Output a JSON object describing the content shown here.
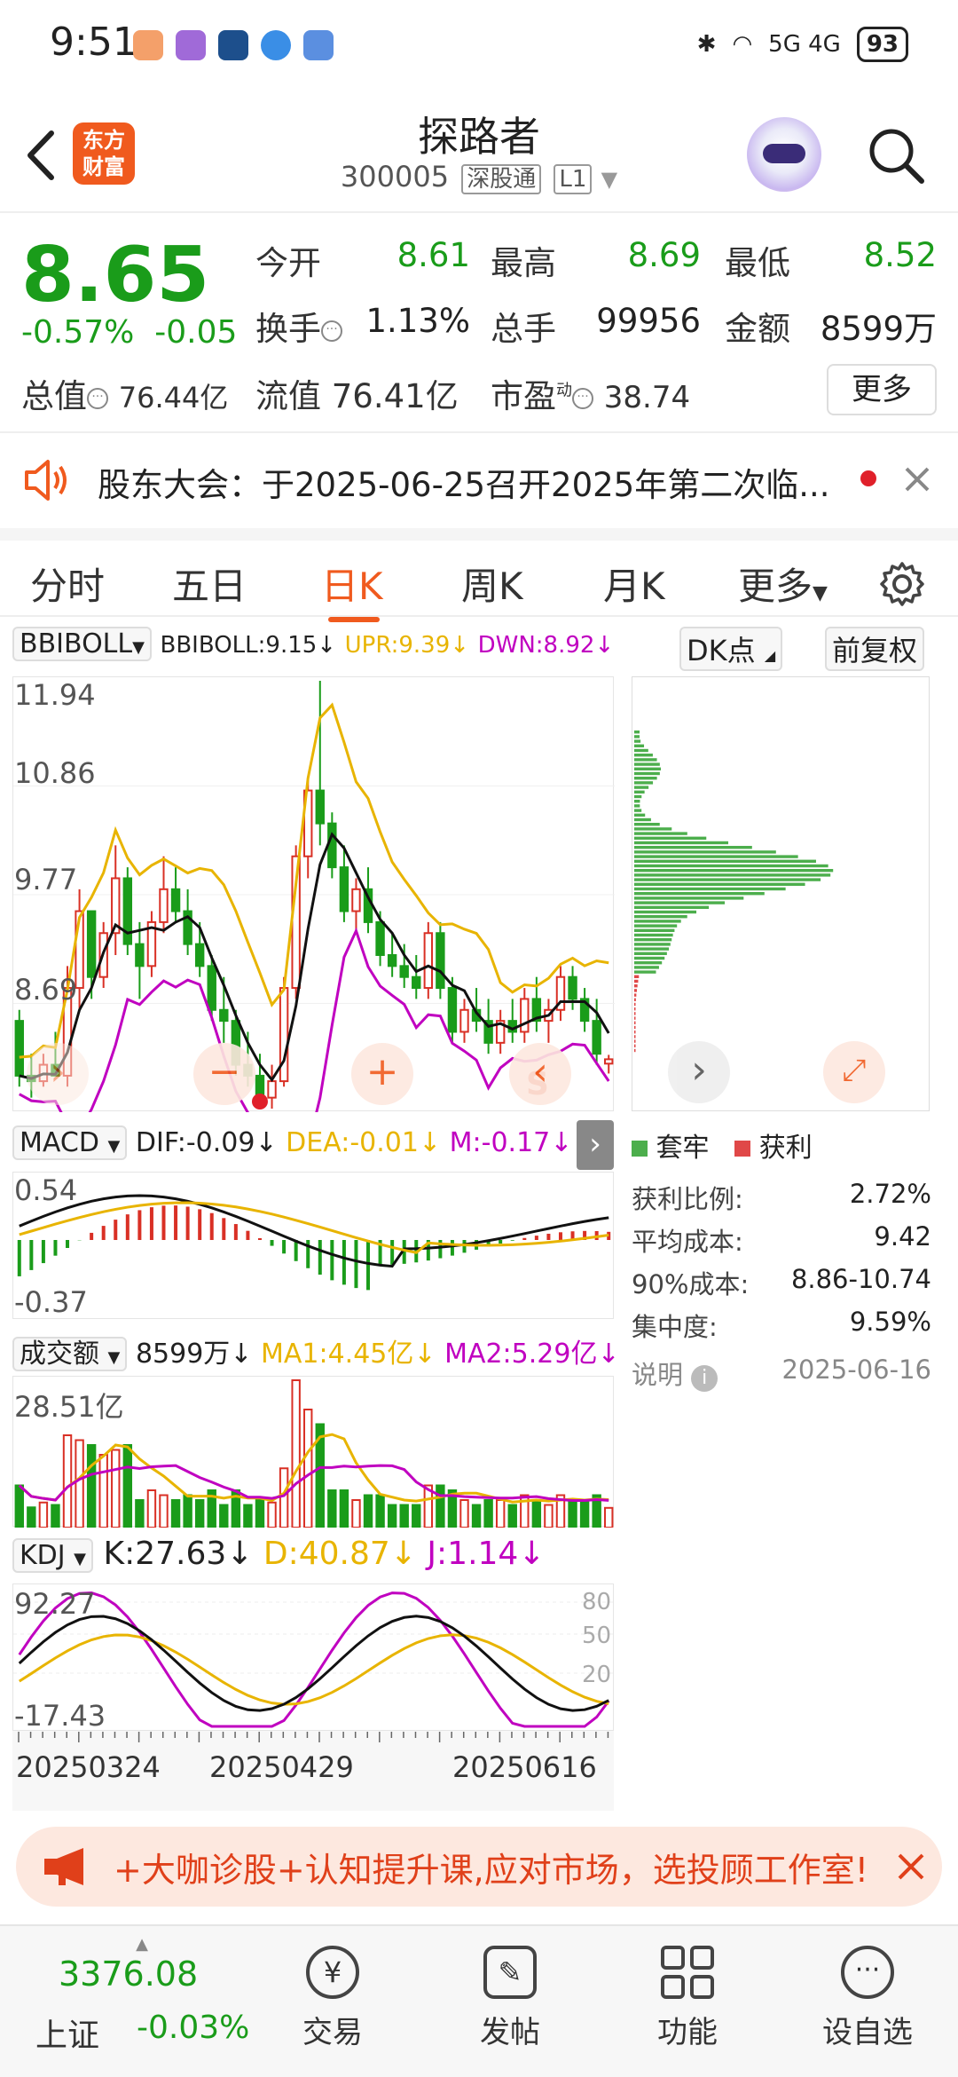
{
  "status_bar": {
    "time": "9:51",
    "network": "5G 4G",
    "battery": "93"
  },
  "header": {
    "logo_text": "东方财富",
    "title": "探路者",
    "code": "300005",
    "tag1": "深股通",
    "tag2": "L1"
  },
  "quote": {
    "price": "8.65",
    "change_pct": "-0.57%",
    "change": "-0.05",
    "open_label": "今开",
    "open": "8.61",
    "high_label": "最高",
    "high": "8.69",
    "low_label": "最低",
    "low": "8.52",
    "turnover_label": "换手",
    "turnover": "1.13%",
    "volume_label": "总手",
    "volume": "99956",
    "amount_label": "金额",
    "amount": "8599万",
    "mcap_label": "总值",
    "mcap": "76.44亿",
    "float_label": "流值",
    "float": "76.41亿",
    "pe_label": "市盈",
    "pe_sup": "动",
    "pe": "38.74",
    "more": "更多"
  },
  "notice": {
    "text": "股东大会：于2025-06-25召开2025年第二次临..."
  },
  "tabs": [
    "分时",
    "五日",
    "日K",
    "周K",
    "月K",
    "更多"
  ],
  "active_tab": "日K",
  "indicators": {
    "main_select": "BBIBOLL",
    "bbi": "BBIBOLL:9.15↓",
    "upr": "UPR:9.39↓",
    "dwn": "DWN:8.92↓",
    "dk": "DK点",
    "adjust": "前复权",
    "macd_select": "MACD",
    "dif": "DIF:-0.09↓",
    "dea": "DEA:-0.01↓",
    "m": "M:-0.17↓",
    "vol_select": "成交额",
    "vol_val": "8599万↓",
    "ma1": "MA1:4.45亿↓",
    "ma2": "MA2:5.29亿↓",
    "kdj_select": "KDJ",
    "k": "K:27.63↓",
    "d": "D:40.87↓",
    "j": "J:1.14↓"
  },
  "price_axis": [
    "11.94",
    "10.86",
    "9.77",
    "8.69"
  ],
  "macd_axis": [
    "0.54",
    "-0.37"
  ],
  "vol_axis": [
    "28.51亿"
  ],
  "kdj_axis": [
    "92.27",
    "-17.43"
  ],
  "kdj_right_axis": [
    "80",
    "50",
    "20"
  ],
  "dates": [
    "20250324",
    "20250429",
    "20250616"
  ],
  "chip": {
    "legend1": "套牢",
    "legend2": "获利",
    "rows": [
      {
        "label": "获利比例:",
        "value": "2.72%"
      },
      {
        "label": "平均成本:",
        "value": "9.42"
      },
      {
        "label": "90%成本:",
        "value": "8.86-10.74"
      },
      {
        "label": "集中度:",
        "value": "9.59%"
      }
    ],
    "note": "说明",
    "date": "2025-06-16"
  },
  "ad": {
    "text": "+大咖诊股+认知提升课,应对市场，选投顾工作室!"
  },
  "bottom_nav": {
    "index_value": "3376.08",
    "index_name": "上证",
    "index_change": "-0.03%",
    "items": [
      "交易",
      "发帖",
      "功能",
      "设自选"
    ]
  },
  "colors": {
    "brand": "#f05a1e",
    "down": "#1a9c1a",
    "up": "#d93025",
    "yellow": "#e8b400",
    "magenta": "#c000c0"
  },
  "chart_data": {
    "type": "candlestick",
    "title": "日K",
    "ylim": [
      8.2,
      12.1
    ],
    "candles": [
      [
        9.0,
        9.1,
        8.4,
        8.5
      ],
      [
        8.5,
        8.7,
        8.3,
        8.45
      ],
      [
        8.45,
        8.7,
        8.4,
        8.6
      ],
      [
        8.6,
        8.9,
        8.5,
        8.5
      ],
      [
        8.5,
        9.5,
        8.4,
        9.3
      ],
      [
        9.3,
        10.2,
        9.1,
        10.0
      ],
      [
        10.0,
        10.0,
        9.2,
        9.4
      ],
      [
        9.4,
        9.9,
        9.3,
        9.8
      ],
      [
        9.8,
        10.6,
        9.6,
        10.3
      ],
      [
        10.3,
        10.4,
        9.6,
        9.7
      ],
      [
        9.7,
        9.9,
        9.2,
        9.5
      ],
      [
        9.5,
        10.0,
        9.4,
        9.9
      ],
      [
        9.9,
        10.5,
        9.8,
        10.2
      ],
      [
        10.2,
        10.4,
        9.9,
        10.0
      ],
      [
        10.0,
        10.2,
        9.6,
        9.7
      ],
      [
        9.7,
        9.9,
        9.4,
        9.5
      ],
      [
        9.5,
        9.6,
        9.0,
        9.1
      ],
      [
        9.1,
        9.4,
        8.8,
        9.0
      ],
      [
        9.0,
        9.1,
        8.5,
        8.6
      ],
      [
        8.6,
        8.9,
        8.4,
        8.5
      ],
      [
        8.5,
        8.7,
        8.2,
        8.3
      ],
      [
        8.3,
        8.6,
        8.2,
        8.45
      ],
      [
        8.45,
        9.4,
        8.4,
        9.3
      ],
      [
        9.3,
        10.6,
        9.2,
        10.5
      ],
      [
        10.5,
        11.2,
        10.3,
        11.1
      ],
      [
        11.1,
        12.1,
        10.6,
        10.8
      ],
      [
        10.8,
        10.9,
        10.3,
        10.4
      ],
      [
        10.4,
        10.6,
        9.9,
        10.0
      ],
      [
        10.0,
        10.3,
        9.8,
        10.2
      ],
      [
        10.2,
        10.4,
        9.8,
        9.9
      ],
      [
        9.9,
        10.0,
        9.5,
        9.6
      ],
      [
        9.6,
        9.8,
        9.4,
        9.5
      ],
      [
        9.5,
        9.7,
        9.3,
        9.4
      ],
      [
        9.4,
        9.6,
        9.2,
        9.3
      ],
      [
        9.3,
        9.9,
        9.2,
        9.8
      ],
      [
        9.8,
        9.9,
        9.2,
        9.3
      ],
      [
        9.3,
        9.4,
        8.8,
        8.9
      ],
      [
        8.9,
        9.2,
        8.8,
        9.1
      ],
      [
        9.1,
        9.3,
        8.9,
        9.0
      ],
      [
        9.0,
        9.2,
        8.7,
        8.8
      ],
      [
        8.8,
        9.1,
        8.7,
        9.0
      ],
      [
        9.0,
        9.2,
        8.8,
        8.9
      ],
      [
        8.9,
        9.3,
        8.8,
        9.2
      ],
      [
        9.2,
        9.4,
        8.9,
        9.0
      ],
      [
        9.0,
        9.2,
        8.8,
        9.1
      ],
      [
        9.1,
        9.5,
        9.0,
        9.4
      ],
      [
        9.4,
        9.5,
        9.1,
        9.2
      ],
      [
        9.2,
        9.3,
        8.9,
        9.0
      ],
      [
        9.0,
        9.2,
        8.6,
        8.7
      ],
      [
        8.61,
        8.69,
        8.52,
        8.65
      ]
    ]
  }
}
